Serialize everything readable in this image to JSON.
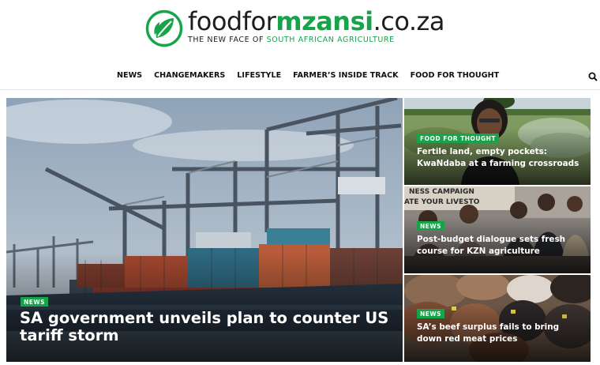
{
  "site": {
    "logo_prefix": "foodfor",
    "logo_accent": "mzansi",
    "logo_suffix": ".co.za",
    "tagline_prefix": "THE NEW FACE OF ",
    "tagline_accent": "SOUTH AFRICAN AGRICULTURE",
    "logo_icon": "leaf-icon",
    "brand_color": "#16a34a"
  },
  "nav": {
    "items": [
      {
        "label": "NEWS"
      },
      {
        "label": "CHANGEMAKERS"
      },
      {
        "label": "LIFESTYLE"
      },
      {
        "label": "FARMER’S INSIDE TRACK"
      },
      {
        "label": "FOOD FOR THOUGHT"
      }
    ],
    "search_icon": "search-icon"
  },
  "hero": {
    "category": "NEWS",
    "title": "SA government unveils plan to counter US tariff storm",
    "image": "container-port-cranes"
  },
  "side_articles": [
    {
      "category": "FOOD FOR THOUGHT",
      "title": "Fertile land, empty pockets: KwaNdaba at a farming crossroads",
      "image": "woman-in-cabbage-field"
    },
    {
      "category": "NEWS",
      "title": "Post-budget dialogue sets fresh course for KZN agriculture",
      "image": "panel-discussion"
    },
    {
      "category": "NEWS",
      "title": "SA’s beef surplus fails to bring down red meat prices",
      "image": "cattle-herd"
    }
  ],
  "overlay_texts": {
    "banner_line1": "NESS CAMPAIGN",
    "banner_line2": "ATE YOUR LIVESTO"
  }
}
